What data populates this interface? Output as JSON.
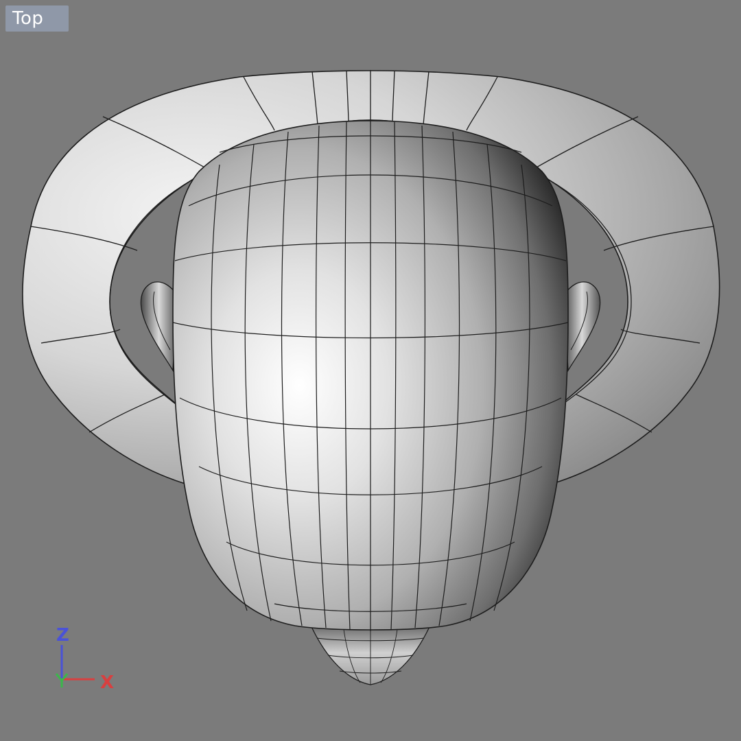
{
  "viewport": {
    "view_name": "Top",
    "background_color": "#7b7b7b"
  },
  "axis_widget": {
    "z_label": "Z",
    "x_label": "X",
    "z_color": "#4a52d8",
    "x_color": "#d84040",
    "y_color": "#3ab84a"
  },
  "model": {
    "icon": "head-model-with-brim",
    "wireframe_color": "#1c1c1c",
    "shading": "gray-gradient"
  }
}
